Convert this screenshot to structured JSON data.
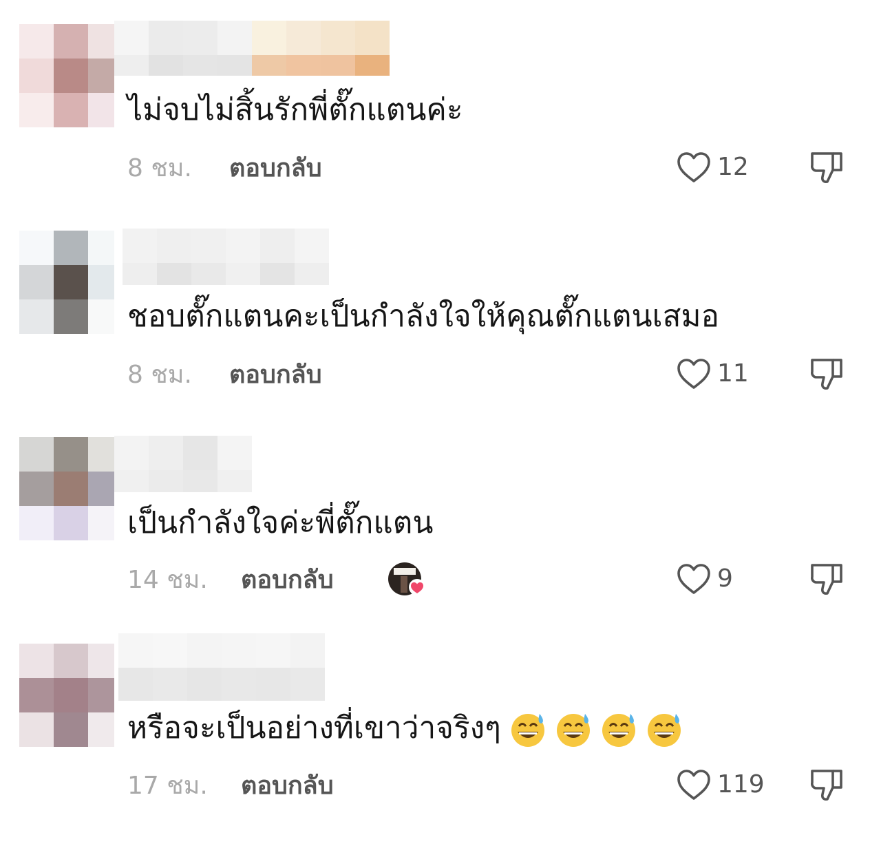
{
  "comments": [
    {
      "text": "ไม่จบไม่สิ้นรักพี่ตั๊กแตนค่ะ",
      "time": "8 ชม.",
      "reply_label": "ตอบกลับ",
      "likes": "12"
    },
    {
      "text": "ชอบตั๊กแตนคะเป็นกำลังใจให้คุณตั๊กแตนเสมอ",
      "time": "8 ชม.",
      "reply_label": "ตอบกลับ",
      "likes": "11"
    },
    {
      "text": "เป็นกำลังใจค่ะพี่ตั๊กแตน",
      "time": "14 ชม.",
      "reply_label": "ตอบกลับ",
      "likes": "9"
    },
    {
      "text": "หรือจะเป็นอย่างที่เขาว่าจริงๆ",
      "time": "17 ชม.",
      "reply_label": "ตอบกลับ",
      "likes": "119"
    }
  ],
  "colors": {
    "text": "#161616",
    "muted": "#a9a9a9",
    "action": "#555555",
    "heart": "#f0476a"
  },
  "icons": {
    "like": "heart-outline-icon",
    "dislike": "thumbs-down-icon",
    "creator_like": "creator-liked-heart-icon",
    "emoji": "grinning-face-with-sweat-icon"
  }
}
